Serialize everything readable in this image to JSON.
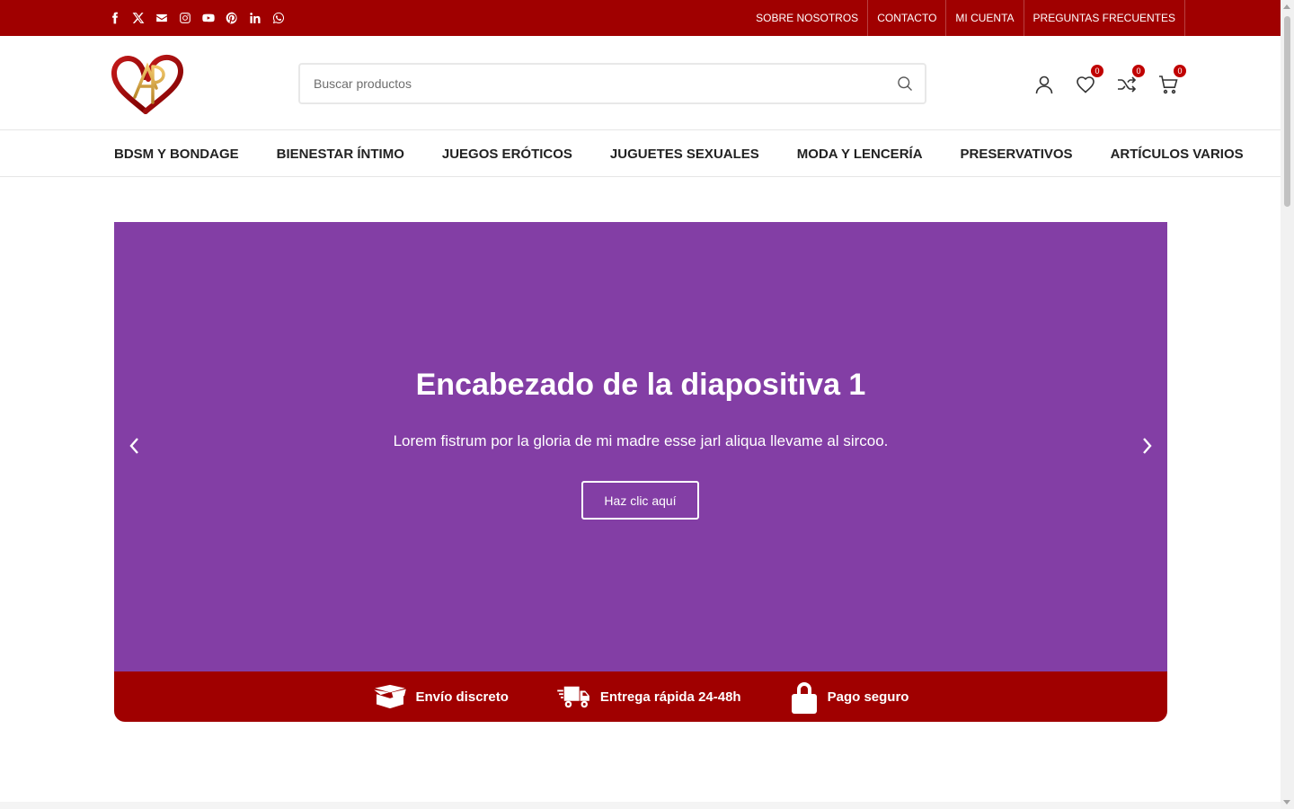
{
  "topbar": {
    "background": "#a00000",
    "social_icons": [
      "facebook-icon",
      "x-icon",
      "email-icon",
      "instagram-icon",
      "youtube-icon",
      "pinterest-icon",
      "linkedin-icon",
      "whatsapp-icon"
    ],
    "links": [
      {
        "label": "SOBRE NOSOTROS"
      },
      {
        "label": "CONTACTO"
      },
      {
        "label": "MI CUENTA"
      },
      {
        "label": "PREGUNTAS FRECUENTES"
      }
    ]
  },
  "header": {
    "search_placeholder": "Buscar productos",
    "wishlist_count": "0",
    "compare_count": "0",
    "cart_count": "0"
  },
  "nav": {
    "items": [
      {
        "label": "BDSM Y BONDAGE"
      },
      {
        "label": "BIENESTAR ÍNTIMO"
      },
      {
        "label": "JUEGOS ERÓTICOS"
      },
      {
        "label": "JUGUETES SEXUALES"
      },
      {
        "label": "MODA Y LENCERÍA"
      },
      {
        "label": "PRESERVATIVOS"
      },
      {
        "label": "ARTÍCULOS VARIOS"
      }
    ]
  },
  "slider": {
    "background": "#833ea5",
    "title": "Encabezado de la diapositiva 1",
    "text": "Lorem fistrum por la gloria de mi madre esse jarl aliqua llevame al sircoo.",
    "button_label": "Haz clic aquí"
  },
  "features": {
    "background": "#a00000",
    "items": [
      {
        "label": "Envío discreto",
        "icon": "box-icon"
      },
      {
        "label": "Entrega rápida 24-48h",
        "icon": "delivery-truck-icon"
      },
      {
        "label": "Pago seguro",
        "icon": "lock-icon"
      }
    ]
  }
}
